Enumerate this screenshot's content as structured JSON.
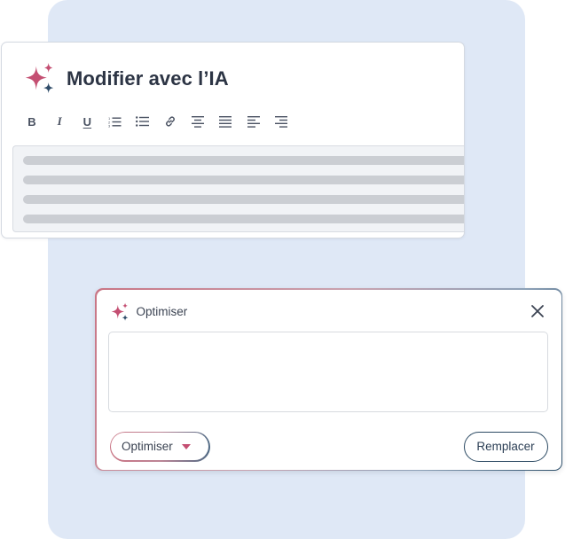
{
  "colors": {
    "background_panel": "#dfe8f6",
    "sparkle_pink": "#c44f72",
    "sparkle_navy": "#2f4c69",
    "heading_text": "#2c3444",
    "button_border": "#2c4a63",
    "select_caret": "#c44f72"
  },
  "editor": {
    "title": "Modifier avec l’IA",
    "title_icon": "sparkle-icon",
    "toolbar": [
      {
        "name": "bold",
        "glyph": "B",
        "icon": "bold-icon"
      },
      {
        "name": "italic",
        "glyph": "I",
        "icon": "italic-icon"
      },
      {
        "name": "underline",
        "glyph": "U",
        "icon": "underline-icon"
      },
      {
        "name": "ordered-list",
        "icon": "ordered-list-icon"
      },
      {
        "name": "bullet-list",
        "icon": "bullet-list-icon"
      },
      {
        "name": "link",
        "icon": "link-icon"
      },
      {
        "name": "align-center",
        "icon": "align-center-icon"
      },
      {
        "name": "align-justify",
        "icon": "align-justify-icon"
      },
      {
        "name": "align-left",
        "icon": "align-left-icon"
      },
      {
        "name": "align-right",
        "icon": "align-right-icon"
      }
    ],
    "placeholder_lines": 4
  },
  "dialog": {
    "title": "Optimiser",
    "title_icon": "sparkle-icon",
    "close_icon": "close-icon",
    "prompt_value": "",
    "prompt_placeholder": "",
    "mode_select": {
      "selected": "Optimiser",
      "caret_icon": "caret-down-icon"
    },
    "replace_label": "Remplacer"
  }
}
